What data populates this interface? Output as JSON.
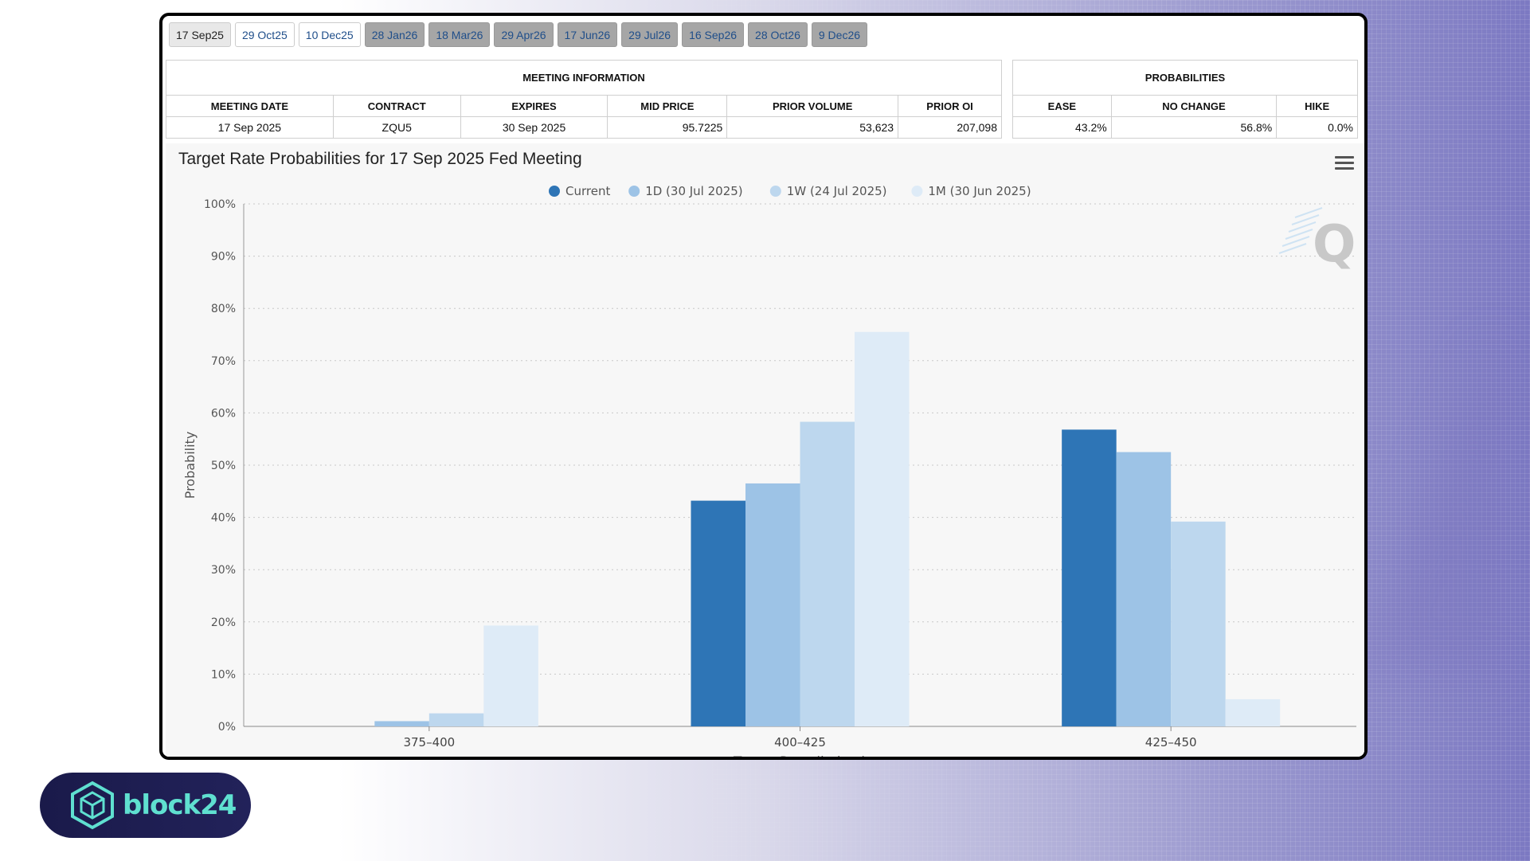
{
  "tabs": [
    {
      "label": "17 Sep25",
      "state": "active"
    },
    {
      "label": "29 Oct25",
      "state": "normal"
    },
    {
      "label": "10 Dec25",
      "state": "normal"
    },
    {
      "label": "28 Jan26",
      "state": "disabled"
    },
    {
      "label": "18 Mar26",
      "state": "disabled"
    },
    {
      "label": "29 Apr26",
      "state": "disabled"
    },
    {
      "label": "17 Jun26",
      "state": "disabled"
    },
    {
      "label": "29 Jul26",
      "state": "disabled"
    },
    {
      "label": "16 Sep26",
      "state": "disabled"
    },
    {
      "label": "28 Oct26",
      "state": "disabled"
    },
    {
      "label": "9 Dec26",
      "state": "disabled"
    }
  ],
  "meeting_info": {
    "header": "MEETING INFORMATION",
    "columns": [
      "MEETING DATE",
      "CONTRACT",
      "EXPIRES",
      "MID PRICE",
      "PRIOR VOLUME",
      "PRIOR OI"
    ],
    "row": [
      "17 Sep 2025",
      "ZQU5",
      "30 Sep 2025",
      "95.7225",
      "53,623",
      "207,098"
    ]
  },
  "probabilities": {
    "header": "PROBABILITIES",
    "columns": [
      "EASE",
      "NO CHANGE",
      "HIKE"
    ],
    "row": [
      "43.2%",
      "56.8%",
      "0.0%"
    ]
  },
  "brand": {
    "name": "block24",
    "accent": "#5fe0d0"
  },
  "chart_data": {
    "type": "bar",
    "title": "Target Rate Probabilities for 17 Sep 2025 Fed Meeting",
    "xlabel": "Target Rate (in bps)",
    "ylabel": "Probability",
    "categories": [
      "375-400",
      "400-425",
      "425-450"
    ],
    "ylim": [
      0,
      100
    ],
    "yticks": [
      "0%",
      "10%",
      "20%",
      "30%",
      "40%",
      "50%",
      "60%",
      "70%",
      "80%",
      "90%",
      "100%"
    ],
    "grid": true,
    "legend_position": "top-center",
    "series": [
      {
        "name": "Current",
        "color": "#2e75b6",
        "values": [
          0,
          43.2,
          56.8
        ]
      },
      {
        "name": "1D (30 Jul 2025)",
        "color": "#9dc3e6",
        "values": [
          1.0,
          46.5,
          52.5
        ]
      },
      {
        "name": "1W (24 Jul 2025)",
        "color": "#bdd7ee",
        "values": [
          2.5,
          58.3,
          39.2
        ]
      },
      {
        "name": "1M (30 Jun 2025)",
        "color": "#deebf7",
        "values": [
          19.3,
          75.5,
          5.2
        ]
      }
    ]
  }
}
